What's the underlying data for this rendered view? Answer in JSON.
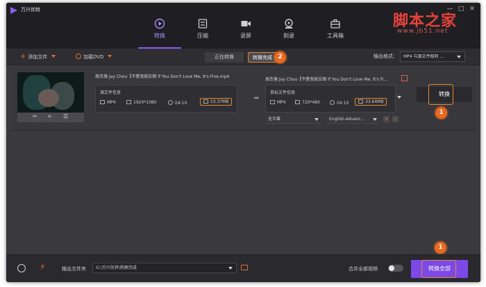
{
  "window": {
    "title": "万兴优转",
    "controls": [
      "—",
      "□",
      "✕"
    ]
  },
  "nav": {
    "items": [
      {
        "label": "转换",
        "icon": "convert-icon",
        "active": true
      },
      {
        "label": "压缩",
        "icon": "compress-icon",
        "active": false
      },
      {
        "label": "录屏",
        "icon": "record-icon",
        "active": false
      },
      {
        "label": "刻录",
        "icon": "burn-icon",
        "active": false
      },
      {
        "label": "工具箱",
        "icon": "toolbox-icon",
        "active": false
      }
    ]
  },
  "toolbar": {
    "add_file": "添加文件",
    "load_dvd": "加载DVD",
    "tab_converting": "正在转换",
    "tab_done": "转换完成",
    "output_format_label": "输出格式:",
    "output_format_value": "MP4 与源文件相同 ..."
  },
  "task": {
    "source_name": "周杰倫 Jay Chou【不愛我就拉倒 If You Don't Love Me, It's Fine.mp4",
    "target_name": "周杰倫 Jay Chou【不愛我就拉倒 If You Don't Love Me, It's Fi...",
    "source_info": {
      "title": "源文件信息",
      "format": "MP4",
      "resolution": "1920*1080",
      "duration": "04:10",
      "size": "53.37MB"
    },
    "target_info": {
      "title": "目标文件信息",
      "format": "MP4",
      "resolution": "720*480",
      "duration": "04:10",
      "size": "33.64MB"
    },
    "subtitle": "无字幕",
    "audio": "English-Advanc...",
    "convert_label": "转换"
  },
  "badges": {
    "one": "1",
    "two": "2"
  },
  "bottom": {
    "output_folder_label": "输出文件夹",
    "output_folder_path": "G:\\万兴优转\\转换完成",
    "merge_label": "合并全部视频",
    "convert_all": "转换全部"
  },
  "watermark": {
    "brand": "脚本之家",
    "url": "www.jb51.net"
  },
  "colors": {
    "accent": "#8a5cf5",
    "highlight": "#e68a2e",
    "badge": "#e86a1e",
    "brand_red": "#e8423b"
  }
}
